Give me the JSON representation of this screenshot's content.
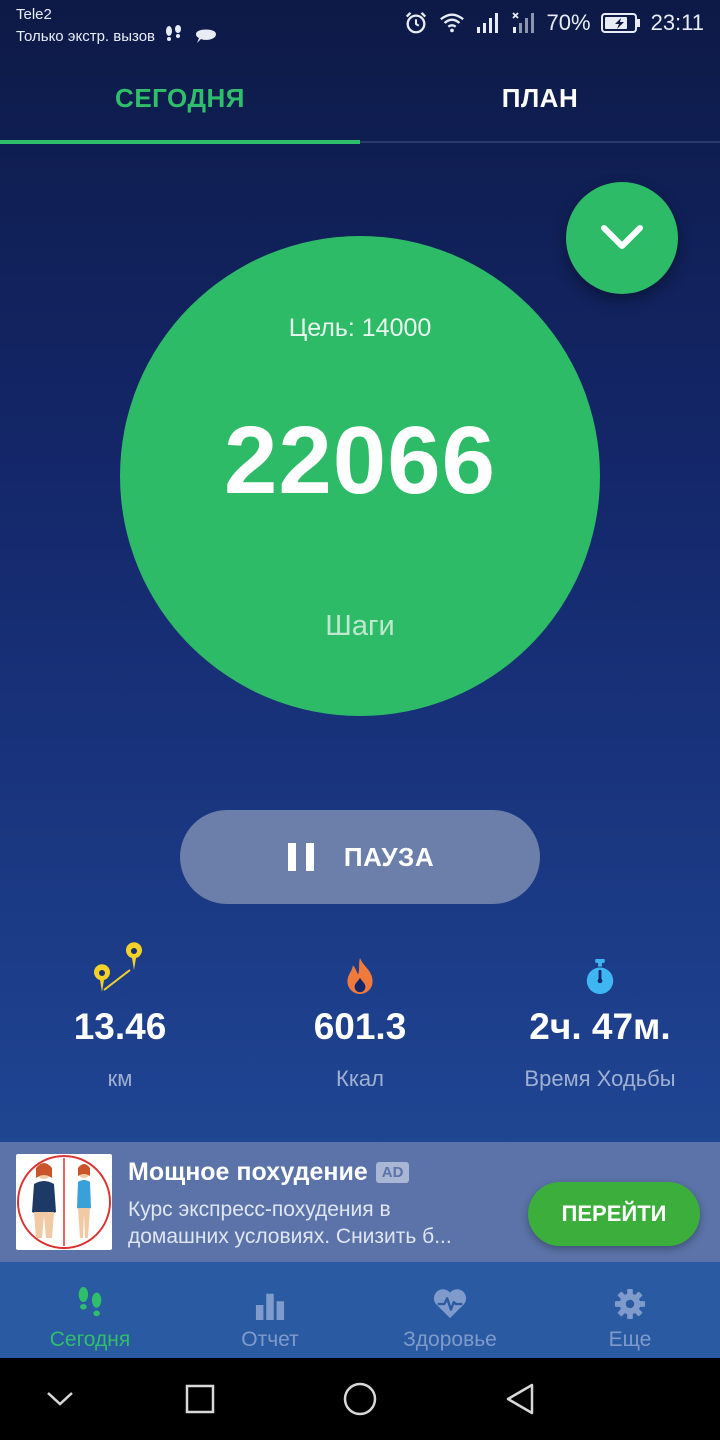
{
  "status_bar": {
    "carrier": "Tele2",
    "carrier_status": "Только экстр. вызов",
    "battery_percent": "70%",
    "time": "23:11"
  },
  "tabs": [
    {
      "label": "СЕГОДНЯ",
      "active": true
    },
    {
      "label": "ПЛАН",
      "active": false
    }
  ],
  "steps_circle": {
    "goal_label": "Цель: 14000",
    "steps_value": "22066",
    "steps_label": "Шаги"
  },
  "pause_button": {
    "label": "ПАУЗА"
  },
  "stats": {
    "distance": {
      "value": "13.46",
      "label": "км",
      "icon": "route-pins-icon"
    },
    "calories": {
      "value": "601.3",
      "label": "Ккал",
      "icon": "flame-icon"
    },
    "walk_time": {
      "value": "2ч. 47м.",
      "label": "Время Ходьбы",
      "icon": "stopwatch-icon"
    }
  },
  "ad": {
    "title": "Мощное похудение",
    "badge": "AD",
    "text_line1": "Курс экспресс-похудения в",
    "text_line2": "домашних условиях. Снизить б...",
    "button_label": "ПЕРЕЙТИ"
  },
  "bottom_nav": [
    {
      "label": "Сегодня",
      "icon": "footsteps-icon",
      "active": true
    },
    {
      "label": "Отчет",
      "icon": "bar-chart-icon",
      "active": false
    },
    {
      "label": "Здоровье",
      "icon": "heart-pulse-icon",
      "active": false
    },
    {
      "label": "Еще",
      "icon": "gear-icon",
      "active": false
    }
  ],
  "colors": {
    "accent_green": "#2dbb67",
    "active_tab": "#2fbf6a",
    "background_top": "#0d1a47",
    "background_bottom": "#23519c",
    "ad_button": "#3cae3c"
  }
}
